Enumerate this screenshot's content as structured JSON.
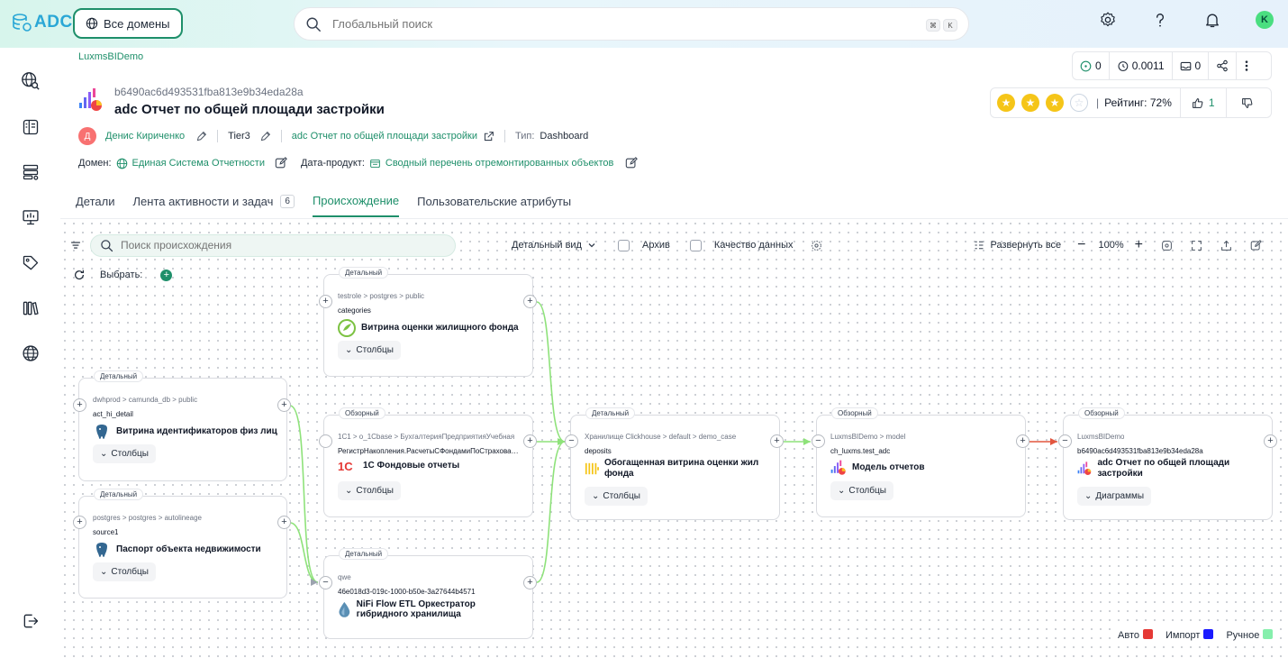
{
  "app": {
    "logo_text": "ADC",
    "domains_button": "Все домены",
    "search_placeholder": "Глобальный поиск",
    "shortcut_keys": [
      "⌘",
      "K"
    ],
    "user_initial": "K"
  },
  "entity": {
    "breadcrumb": "LuxmsBIDemo",
    "id": "b6490ac6d493531fba813e9b34eda28a",
    "title": "adc Отчет по общей площади застройки",
    "owner_initial": "Д",
    "owner_name": "Денис Кириченко",
    "tier": "Tier3",
    "parent_link": "adc Отчет по общей площади застройки",
    "type_label": "Тип:",
    "type_value": "Dashboard",
    "domain_label": "Домен:",
    "domain_value": "Единая Система Отчетности",
    "product_label": "Дата-продукт:",
    "product_value": "Сводный перечень отремонтированных объектов"
  },
  "stats": {
    "checks": "0",
    "history": "0.0011",
    "messages": "0"
  },
  "rating": {
    "filled_stars": 3,
    "total_stars": 4,
    "label": "Рейтинг: 72%",
    "likes": "1"
  },
  "tabs": [
    {
      "label": "Детали",
      "active": false
    },
    {
      "label": "Лента активности и задач",
      "count": "6",
      "active": false
    },
    {
      "label": "Происхождение",
      "active": true
    },
    {
      "label": "Пользовательские атрибуты",
      "active": false
    }
  ],
  "lineage_toolbar": {
    "search_placeholder": "Поиск происхождения",
    "view_mode": "Детальный вид",
    "archive": "Архив",
    "quality": "Качество данных",
    "expand_all": "Развернуть все",
    "zoom": "100%",
    "select_label": "Выбрать:"
  },
  "nodes": [
    {
      "badge": "Детальный",
      "path": "testrole > postgres > public",
      "sub": "categories",
      "name": "Витрина оценки жилищного фонда",
      "button": "Столбцы",
      "icon": "green-circle-icon"
    },
    {
      "badge": "Детальный",
      "path": "dwhprod > camunda_db > public",
      "sub": "act_hi_detail",
      "name": "Витрина идентификаторов физ лиц",
      "button": "Столбцы",
      "icon": "postgres-icon"
    },
    {
      "badge": "Обзорный",
      "path": "1C1 > o_1Cbase > БухгалтерияПредприятияУчебная",
      "sub": "РегистрНакопления.РасчетыСФондамиПоСтрахованию",
      "name": "1С Фондовые отчеты",
      "button": "Столбцы",
      "icon": "1c-icon"
    },
    {
      "badge": "Детальный",
      "path": "postgres > postgres > autolineage",
      "sub": "source1",
      "name": "Паспорт объекта недвижимости",
      "button": "Столбцы",
      "icon": "postgres-icon"
    },
    {
      "badge": "Детальный",
      "path": "qwe",
      "sub": "46e018d3-019c-1000-b50e-3a27644b4571",
      "name": "NiFi Flow ETL Оркестратор гибридного хранилища",
      "button": "",
      "icon": "nifi-drop-icon"
    },
    {
      "badge": "Детальный",
      "path": "Хранилище Clickhouse > default > demo_case",
      "sub": "deposits",
      "name": "Обогащенная витрина оценки жил фонда",
      "button": "Столбцы",
      "icon": "clickhouse-icon"
    },
    {
      "badge": "Обзорный",
      "path": "LuxmsBIDemo > model",
      "sub": "ch_luxms.test_adc",
      "name": "Модель отчетов",
      "button": "Столбцы",
      "icon": "luxms-icon"
    },
    {
      "badge": "Обзорный",
      "path": "LuxmsBIDemo",
      "sub": "b6490ac6d493531fba813e9b34eda28a",
      "name": "adc Отчет по общей площади застройки",
      "button": "Диаграммы",
      "icon": "luxms-icon"
    }
  ],
  "legend": [
    {
      "label": "Авто",
      "color": "#e53935"
    },
    {
      "label": "Импорт",
      "color": "#1a1aff"
    },
    {
      "label": "Ручное",
      "color": "#86efac"
    }
  ],
  "colors": {
    "accent": "#1e8f6a",
    "edge_green": "#86e06e",
    "edge_red": "#e2563f"
  }
}
